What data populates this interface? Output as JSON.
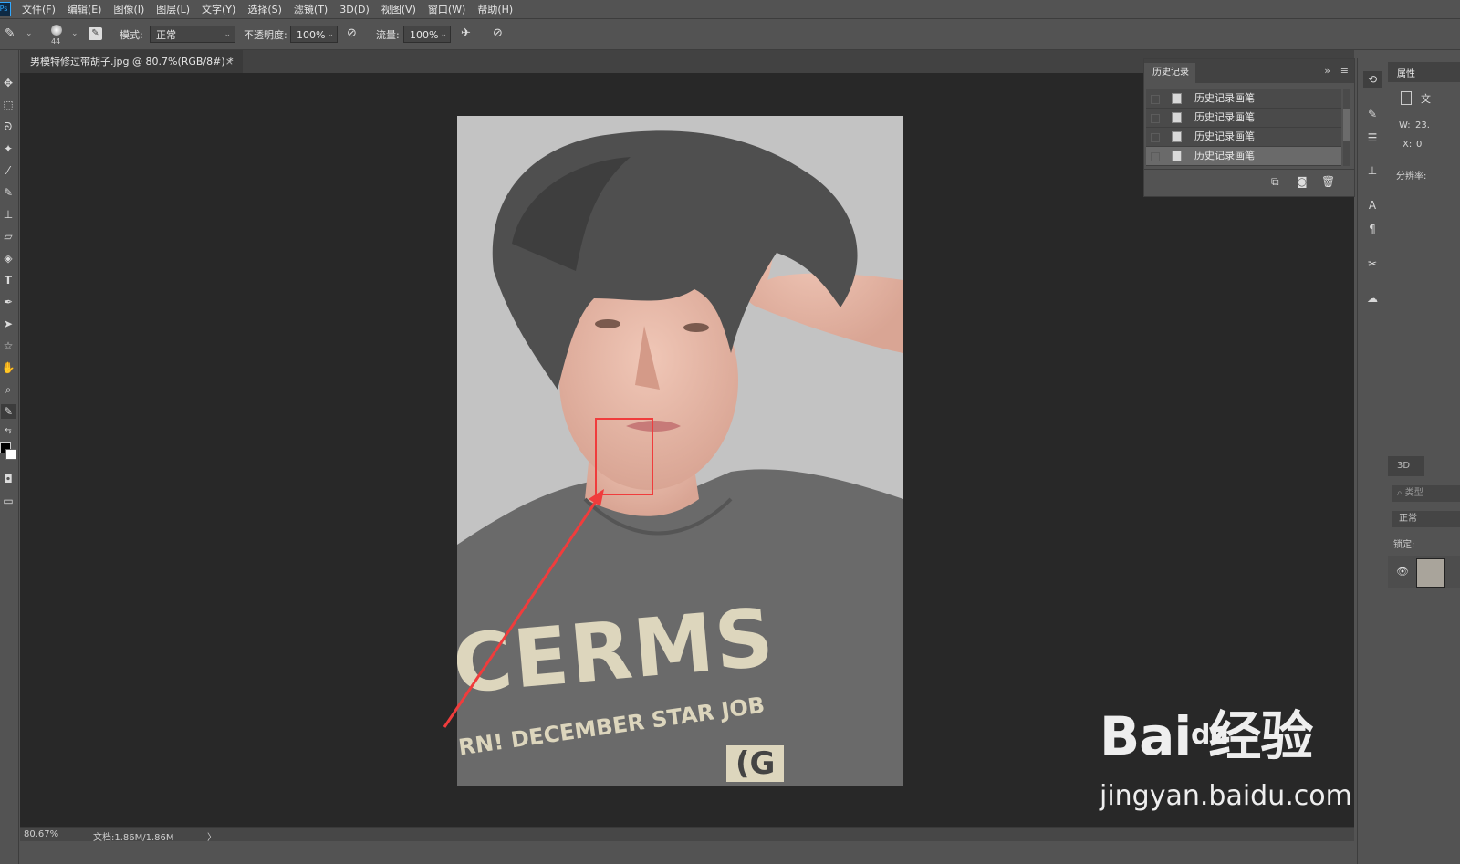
{
  "menu": {
    "logo": "Ps",
    "items": [
      "文件(F)",
      "编辑(E)",
      "图像(I)",
      "图层(L)",
      "文字(Y)",
      "选择(S)",
      "滤镜(T)",
      "3D(D)",
      "视图(V)",
      "窗口(W)",
      "帮助(H)"
    ]
  },
  "options": {
    "brush_size": "44",
    "mode_label": "模式:",
    "mode_value": "正常",
    "opacity_label": "不透明度:",
    "opacity_value": "100%",
    "flow_label": "流量:",
    "flow_value": "100%"
  },
  "document": {
    "tab_title": "男模特修过带胡子.jpg @ 80.7%(RGB/8#) *",
    "tab_close": "×"
  },
  "photo": {
    "shirt_text_1": "CERMS",
    "shirt_text_2": "RN! DECEMBER STAR JOB",
    "shirt_text_3": "(G"
  },
  "status": {
    "zoom": "80.67%",
    "doc_info": "文档:1.86M/1.86M",
    "arrow": "〉"
  },
  "history": {
    "tab_label": "历史记录",
    "expand": "»",
    "menu": "≡",
    "rows": [
      "历史记录画笔",
      "历史记录画笔",
      "历史记录画笔",
      "历史记录画笔"
    ]
  },
  "properties": {
    "tab_label": "属性",
    "doc_label": "文",
    "w_label": "W:",
    "w_value": "23.",
    "x_label": "X:",
    "x_value": "0",
    "resolution_label": "分辨率:"
  },
  "layers": {
    "tab_3d": "3D",
    "search_placeholder": "类型",
    "blend": "正常",
    "lock_label": "锁定:"
  },
  "watermark": {
    "logo": "Bai 经验",
    "logo_inner": "du",
    "url": "jingyan.baidu.com"
  },
  "colors": {
    "annotation_red": "#f03c3c",
    "canvas_bg": "#282828",
    "panel_bg": "#535353"
  }
}
